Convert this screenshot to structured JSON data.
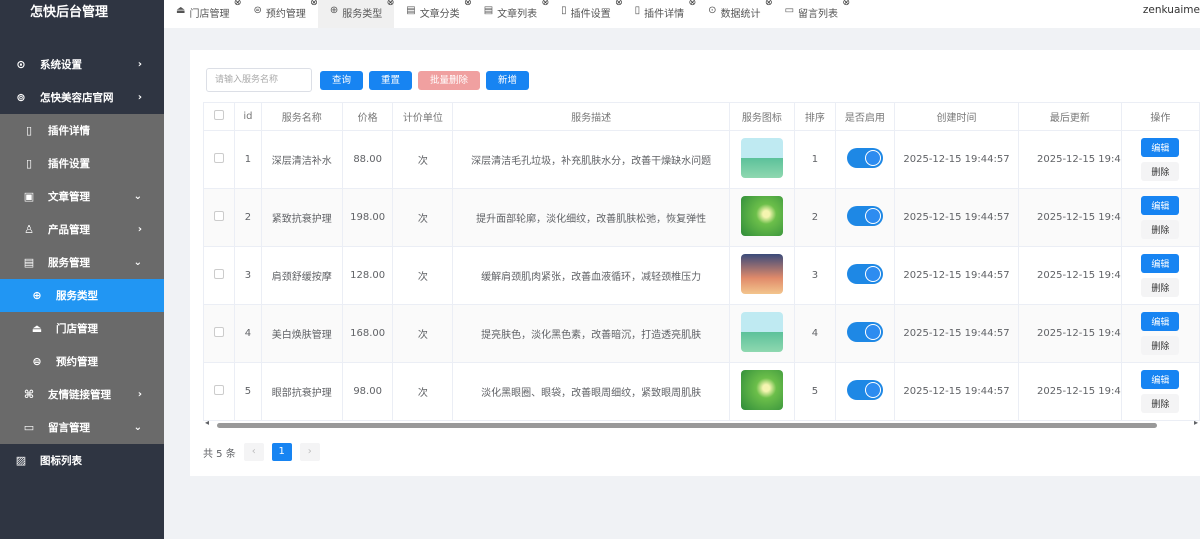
{
  "app": {
    "title": "怎快后台管理",
    "user": "zenkuaime"
  },
  "sidebar": {
    "items": [
      {
        "label": "系统设置",
        "icon": "gear-icon",
        "arrow": "›"
      },
      {
        "label": "怎快美容店官网",
        "icon": "triangle-icon",
        "arrow": "›"
      },
      {
        "label": "插件详情",
        "icon": "document-icon"
      },
      {
        "label": "插件设置",
        "icon": "document-icon"
      },
      {
        "label": "文章管理",
        "icon": "book-icon",
        "arrow": "⌄"
      },
      {
        "label": "产品管理",
        "icon": "product-icon",
        "arrow": "›"
      },
      {
        "label": "服务管理",
        "icon": "service-icon",
        "arrow": "⌄"
      },
      {
        "label": "服务类型",
        "icon": "type-icon"
      },
      {
        "label": "门店管理",
        "icon": "store-icon"
      },
      {
        "label": "预约管理",
        "icon": "appointment-icon"
      },
      {
        "label": "友情链接管理",
        "icon": "link-icon",
        "arrow": "›"
      },
      {
        "label": "留言管理",
        "icon": "message-icon",
        "arrow": "⌄"
      },
      {
        "label": "图标列表",
        "icon": "image-icon"
      }
    ]
  },
  "tabs": [
    {
      "label": "门店管理"
    },
    {
      "label": "预约管理"
    },
    {
      "label": "服务类型"
    },
    {
      "label": "文章分类"
    },
    {
      "label": "文章列表"
    },
    {
      "label": "插件设置"
    },
    {
      "label": "插件详情"
    },
    {
      "label": "数据统计"
    },
    {
      "label": "留言列表"
    }
  ],
  "toolbar": {
    "search_placeholder": "请输入服务名称",
    "query": "查询",
    "reset": "重置",
    "batch_delete": "批量删除",
    "add": "新增"
  },
  "table": {
    "headers": [
      "id",
      "服务名称",
      "价格",
      "计价单位",
      "服务描述",
      "服务图标",
      "排序",
      "是否启用",
      "创建时间",
      "最后更新",
      "操作"
    ],
    "rows": [
      {
        "id": "1",
        "name": "深层清洁补水",
        "price": "88.00",
        "unit": "次",
        "desc": "深层清洁毛孔垃圾，补充肌肤水分，改善干燥缺水问题",
        "sort": "1",
        "enabled": true,
        "created": "2025-12-15 19:44:57",
        "updated": "2025-12-15 19:4"
      },
      {
        "id": "2",
        "name": "紧致抗衰护理",
        "price": "198.00",
        "unit": "次",
        "desc": "提升面部轮廓，淡化细纹，改善肌肤松弛，恢复弹性",
        "sort": "2",
        "enabled": true,
        "created": "2025-12-15 19:44:57",
        "updated": "2025-12-15 19:4"
      },
      {
        "id": "3",
        "name": "肩颈舒缓按摩",
        "price": "128.00",
        "unit": "次",
        "desc": "缓解肩颈肌肉紧张，改善血液循环，减轻颈椎压力",
        "sort": "3",
        "enabled": true,
        "created": "2025-12-15 19:44:57",
        "updated": "2025-12-15 19:4"
      },
      {
        "id": "4",
        "name": "美白焕肤管理",
        "price": "168.00",
        "unit": "次",
        "desc": "提亮肤色，淡化黑色素，改善暗沉，打造透亮肌肤",
        "sort": "4",
        "enabled": true,
        "created": "2025-12-15 19:44:57",
        "updated": "2025-12-15 19:4"
      },
      {
        "id": "5",
        "name": "眼部抗衰护理",
        "price": "98.00",
        "unit": "次",
        "desc": "淡化黑眼圈、眼袋，改善眼周细纹，紧致眼周肌肤",
        "sort": "5",
        "enabled": true,
        "created": "2025-12-15 19:44:57",
        "updated": "2025-12-15 19:4"
      }
    ],
    "edit": "编辑",
    "delete": "删除"
  },
  "pagination": {
    "total": "共 5 条",
    "current": "1",
    "prev": "‹",
    "next": "›"
  }
}
